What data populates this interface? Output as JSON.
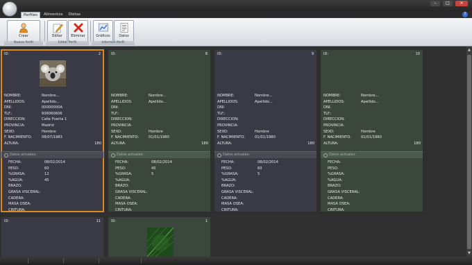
{
  "tabs": [
    {
      "label": "Perfiles",
      "active": true
    },
    {
      "label": "Alimentos",
      "active": false
    },
    {
      "label": "Dietas",
      "active": false
    }
  ],
  "ribbon": {
    "groups": [
      {
        "label": "Nuevo Perfil",
        "buttons": [
          {
            "label": "Crear",
            "icon": "person-add-icon"
          }
        ]
      },
      {
        "label": "Editar Perfil",
        "buttons": [
          {
            "label": "Editar",
            "icon": "edit-icon"
          },
          {
            "label": "Eliminar",
            "icon": "delete-icon"
          }
        ]
      },
      {
        "label": "Informes Perfil",
        "buttons": [
          {
            "label": "Gráficos",
            "icon": "chart-icon"
          },
          {
            "label": "Datos",
            "icon": "data-sheet-icon"
          }
        ]
      }
    ]
  },
  "labels": {
    "id": "ID:",
    "nombre": "NOMBRE:",
    "apellidos": "APELLIDOS:",
    "dni": "DNI:",
    "tlf": "TLF.:",
    "direccion": "DIRECCION:",
    "provincia": "PROVINCIA:",
    "sexo": "SEXO:",
    "nacimiento": "F. NACIMIENTO:",
    "altura": "ALTURA:",
    "datos_actuales": "Datos actuales:",
    "fecha": "FECHA:",
    "peso": "PESO:",
    "grasa": "%GRASA:",
    "agua": "%AGUA:",
    "brazo": "BRAZO:",
    "grasa_visceral": "GRASA VISCERAL:",
    "cadera": "CADERA:",
    "masa_osea": "MASA OSEA:",
    "cintura": "CINTURA:"
  },
  "cards": [
    {
      "num": "2",
      "nombre": "Nombre...",
      "apellidos": "Apellido...",
      "dni": "00000000A",
      "tlf": "606060606",
      "direccion": "Calle Puerta 1",
      "provincia": "Madrid",
      "sexo": "Hombre",
      "nacimiento": "08/07/1983",
      "altura": "180",
      "fecha": "08/02/2014",
      "peso": "60",
      "grasa": "12",
      "agua": "45"
    },
    {
      "num": "8",
      "nombre": "Nombre...",
      "apellidos": "Apellido...",
      "dni": "",
      "tlf": "",
      "direccion": "",
      "provincia": "",
      "sexo": "Hombre",
      "nacimiento": "01/01/1980",
      "altura": "180",
      "fecha": "08/02/2014",
      "peso": "45",
      "grasa": "5",
      "agua": ""
    },
    {
      "num": "9",
      "nombre": "Nombre...",
      "apellidos": "Apellido...",
      "dni": "",
      "tlf": "",
      "direccion": "",
      "provincia": "",
      "sexo": "Hombre",
      "nacimiento": "01/01/1980",
      "altura": "180",
      "fecha": "08/02/2014",
      "peso": "60",
      "grasa": "5",
      "agua": ""
    },
    {
      "num": "10",
      "nombre": "Nombre...",
      "apellidos": "Apellido...",
      "dni": "",
      "tlf": "",
      "direccion": "",
      "provincia": "",
      "sexo": "Hombre",
      "nacimiento": "01/01/1980",
      "altura": "180",
      "fecha": "",
      "peso": "",
      "grasa": "",
      "agua": ""
    },
    {
      "num": "11"
    },
    {
      "num": "1"
    }
  ],
  "colors": {
    "selected_outline": "#e08a1e",
    "card_purple": "#3a3a47",
    "card_green": "#3b473d"
  }
}
